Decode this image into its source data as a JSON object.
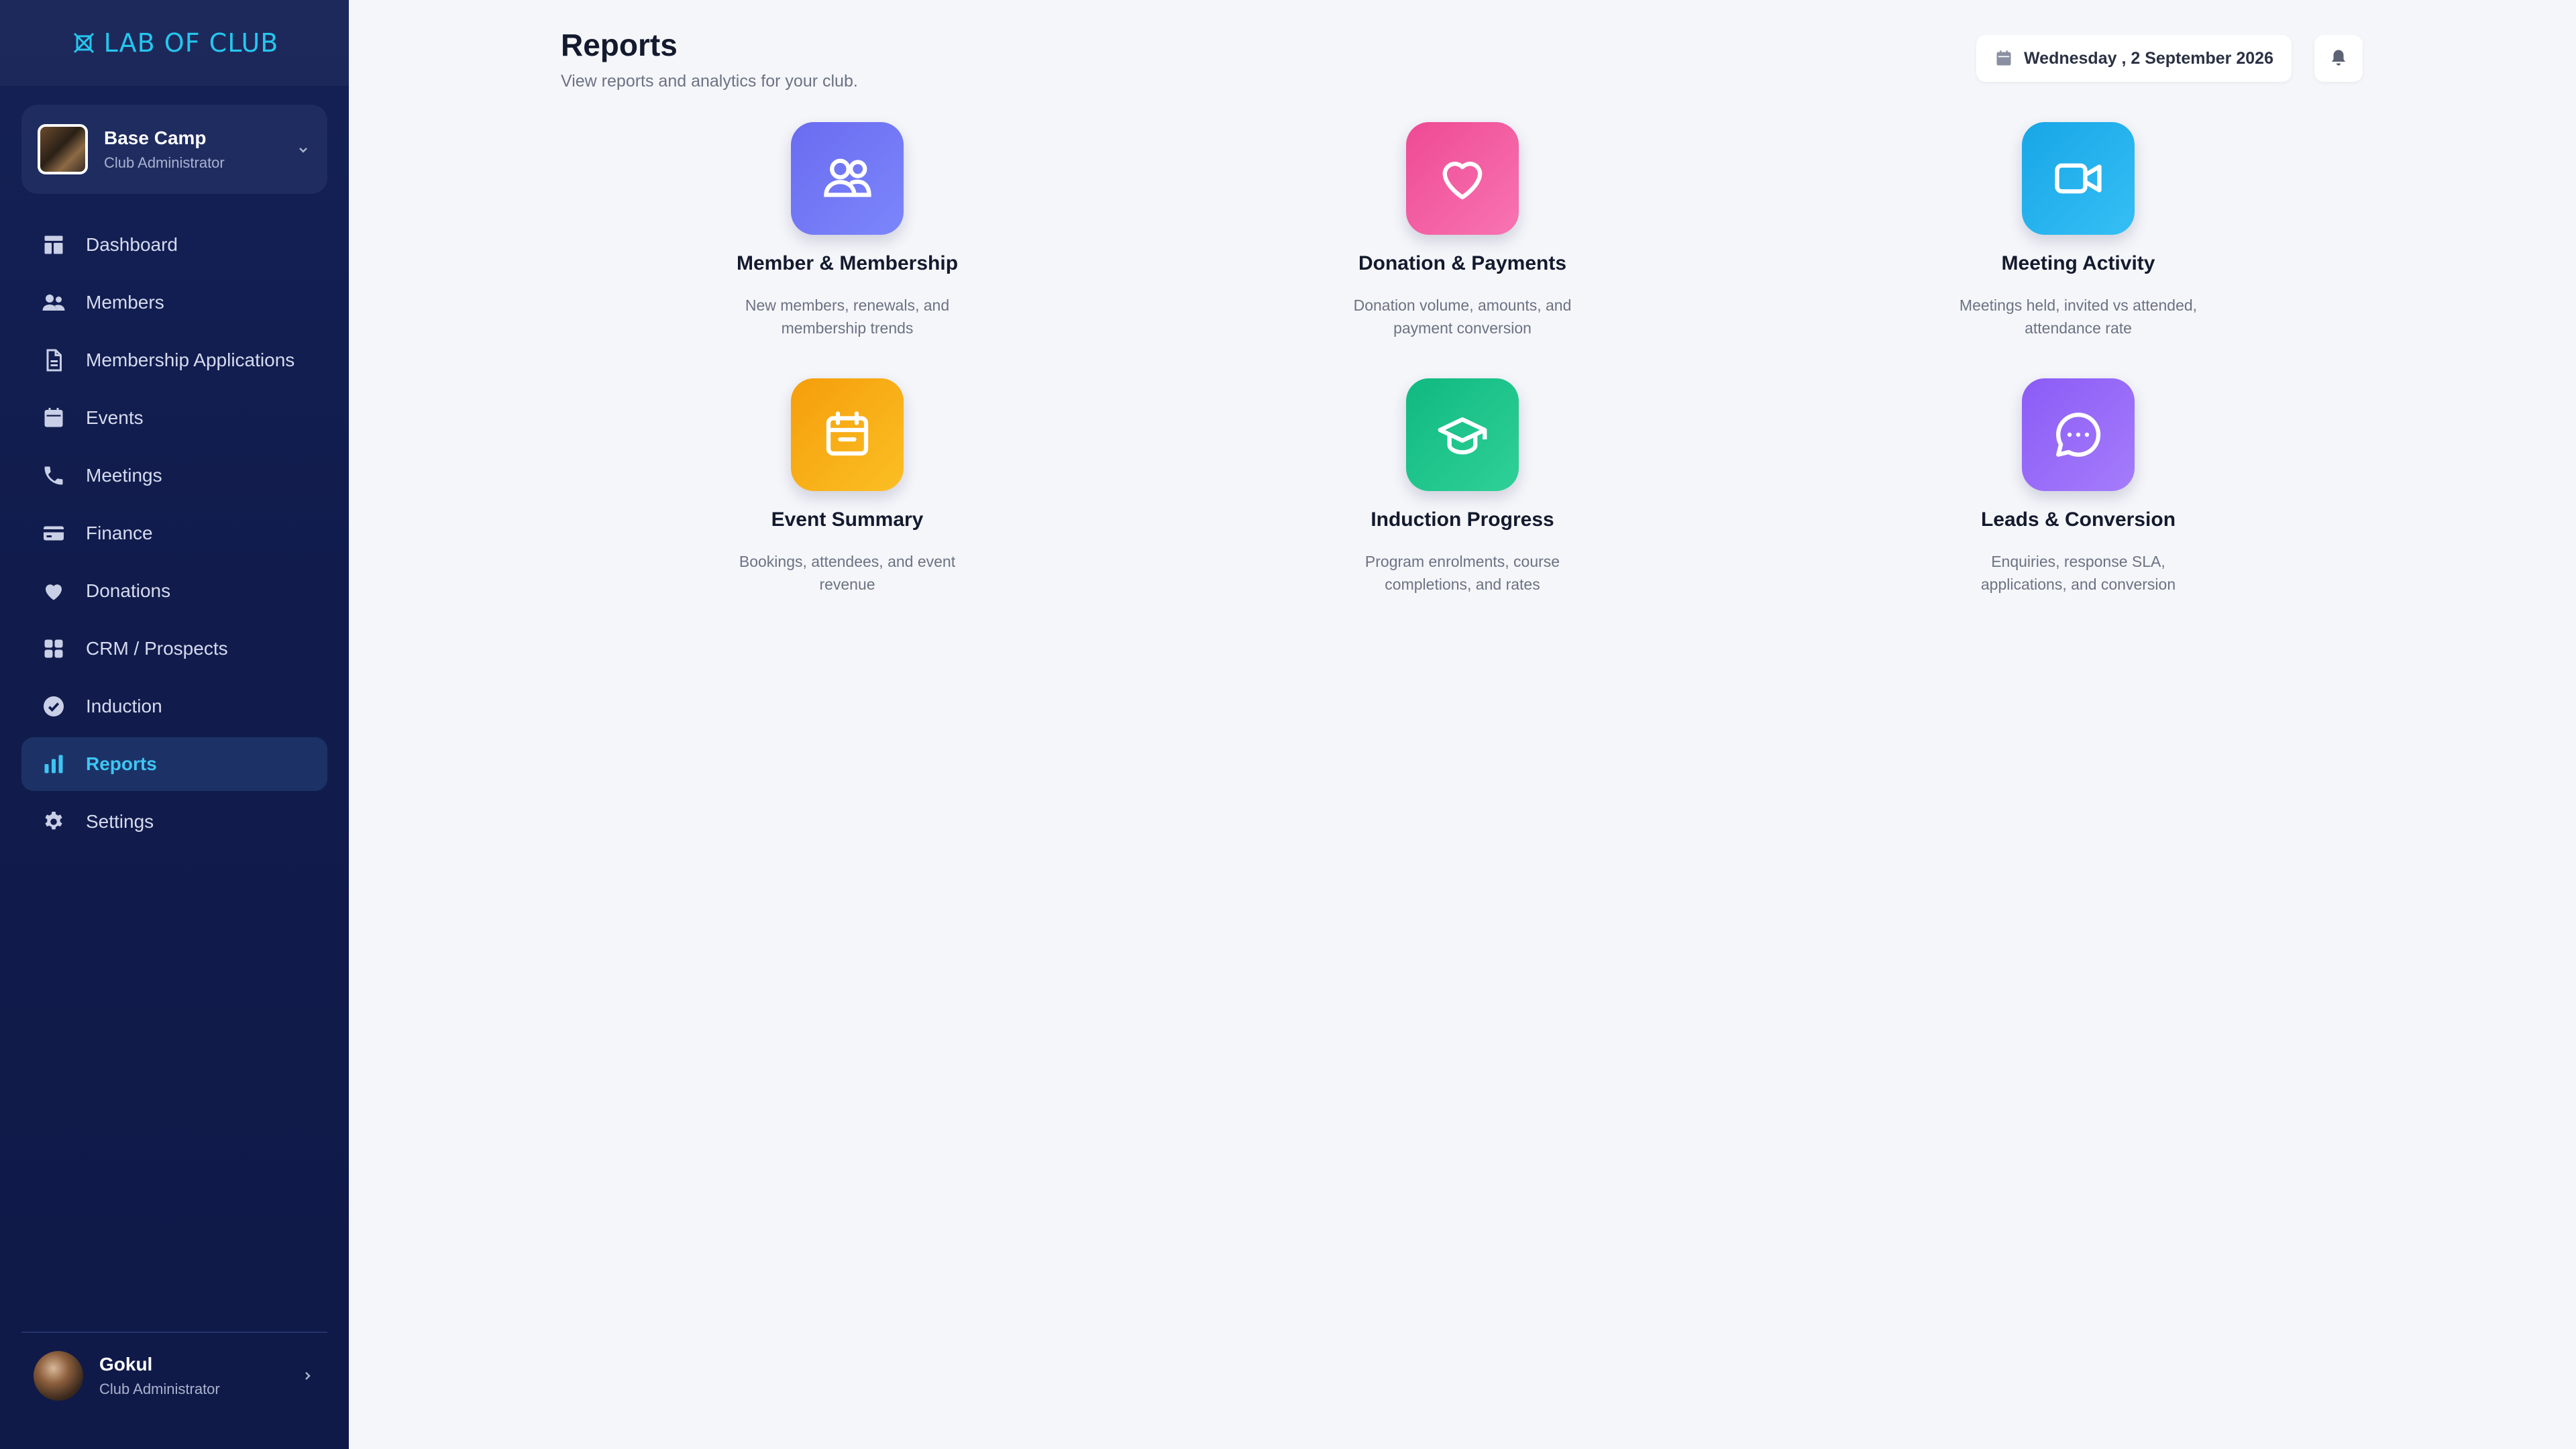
{
  "sidebar": {
    "brand": "LAB OF CLUB",
    "club": {
      "name": "Base Camp",
      "role": "Club Administrator"
    },
    "items": [
      {
        "label": "Dashboard",
        "icon": "dashboard-icon"
      },
      {
        "label": "Members",
        "icon": "members-icon"
      },
      {
        "label": "Membership Applications",
        "icon": "document-icon"
      },
      {
        "label": "Events",
        "icon": "calendar-icon"
      },
      {
        "label": "Meetings",
        "icon": "phone-icon"
      },
      {
        "label": "Finance",
        "icon": "credit-card-icon"
      },
      {
        "label": "Donations",
        "icon": "heart-icon"
      },
      {
        "label": "CRM / Prospects",
        "icon": "grid-icon"
      },
      {
        "label": "Induction",
        "icon": "check-circle-icon"
      },
      {
        "label": "Reports",
        "icon": "bar-chart-icon",
        "active": true
      },
      {
        "label": "Settings",
        "icon": "gear-icon"
      }
    ],
    "user": {
      "name": "Gokul",
      "role": "Club Administrator"
    }
  },
  "header": {
    "title": "Reports",
    "subtitle": "View reports and analytics for your club.",
    "date": "Wednesday , 2 September 2026"
  },
  "reports": [
    {
      "title": "Member & Membership",
      "description": "New members, renewals, and membership trends",
      "icon": "users-icon",
      "color": "#6a6cf0"
    },
    {
      "title": "Donation & Payments",
      "description": "Donation volume, amounts, and payment conversion",
      "icon": "heart-icon",
      "color": "#ee4a93"
    },
    {
      "title": "Meeting Activity",
      "description": "Meetings held, invited vs attended, attendance rate",
      "icon": "video-icon",
      "color": "#18a6e6"
    },
    {
      "title": "Event Summary",
      "description": "Bookings, attendees, and event revenue",
      "icon": "calendar-icon",
      "color": "#f59e0b"
    },
    {
      "title": "Induction Progress",
      "description": "Program enrolments, course completions, and rates",
      "icon": "graduation-cap-icon",
      "color": "#10b981"
    },
    {
      "title": "Leads & Conversion",
      "description": "Enquiries, response SLA, applications, and conversion",
      "icon": "chat-bubble-icon",
      "color": "#8b5cf6"
    }
  ],
  "colors": {
    "sidebar_bg": "#111c4d",
    "accent": "#25c6ee",
    "page_bg": "#f5f6fa"
  }
}
